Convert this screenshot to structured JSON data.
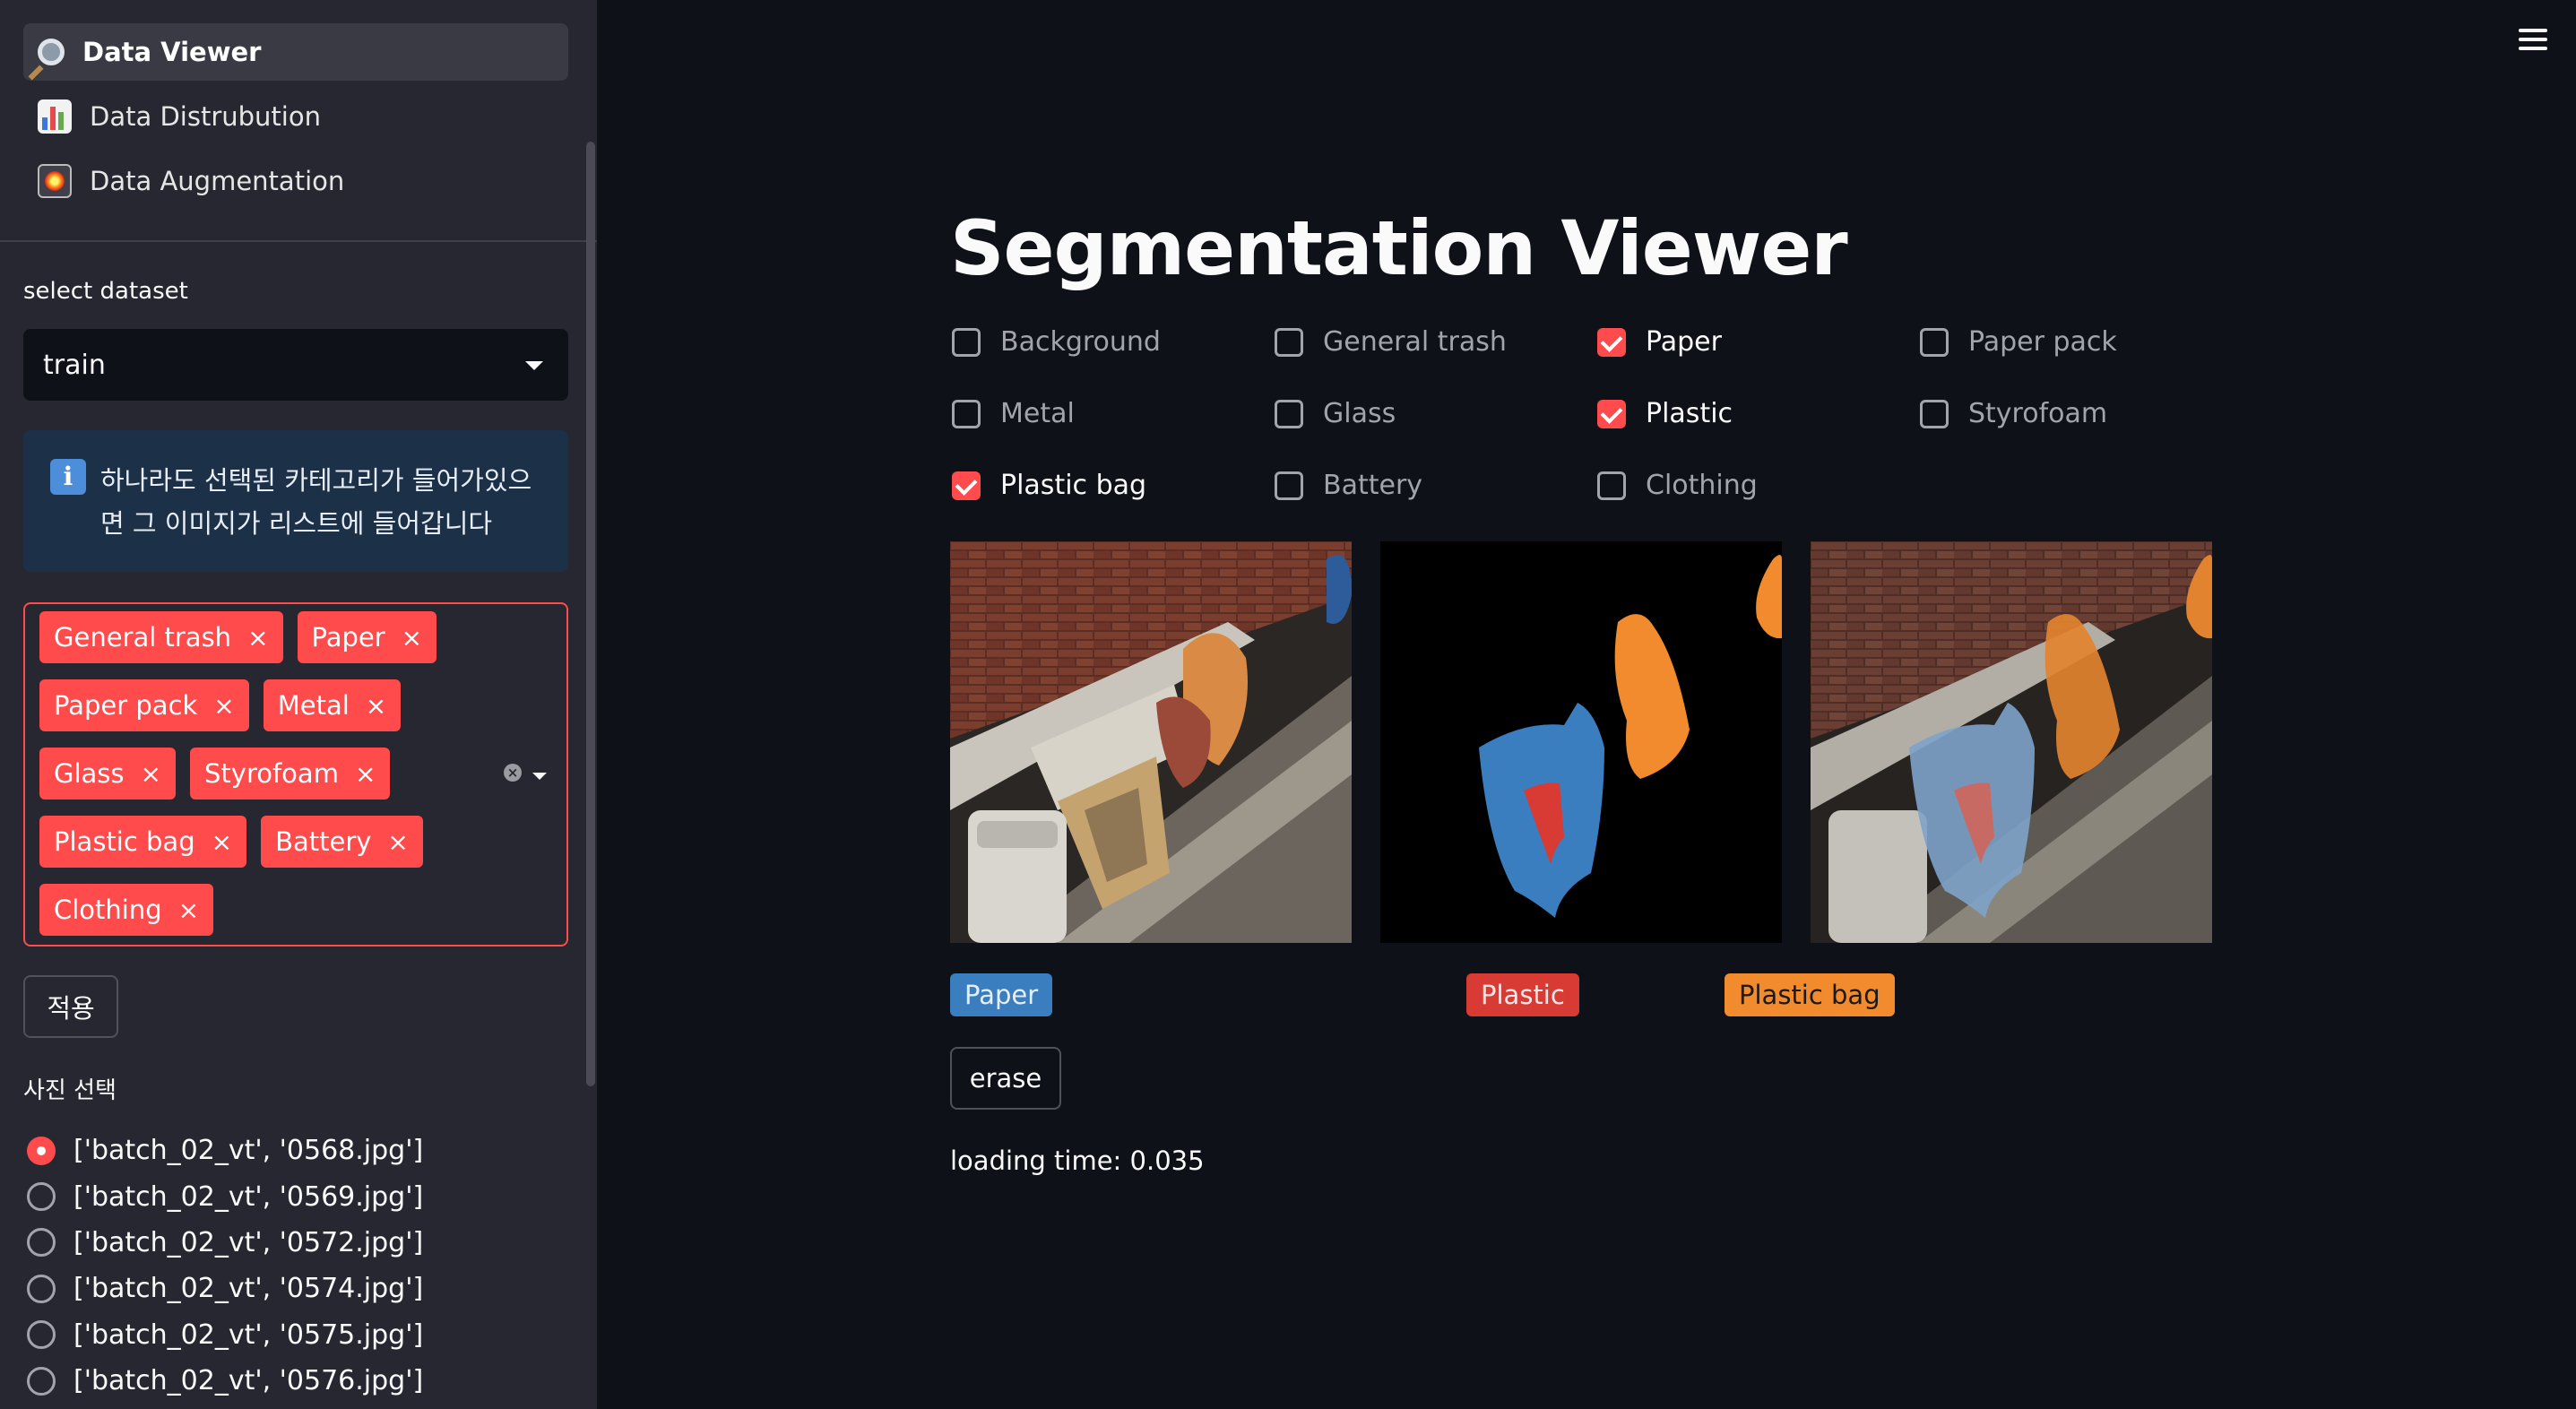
{
  "sidebar": {
    "nav": [
      {
        "label": "Data Viewer",
        "icon": "magnifier-icon",
        "active": true
      },
      {
        "label": "Data Distrubution",
        "icon": "bar-chart-icon",
        "active": false
      },
      {
        "label": "Data Augmentation",
        "icon": "fireworks-icon",
        "active": false
      }
    ],
    "dataset_label": "select dataset",
    "dataset_value": "train",
    "info_text": "하나라도 선택된 카테고리가 들어가있으면 그 이미지가 리스트에 들어갑니다",
    "info_icon": "information-icon",
    "tags": [
      "General trash",
      "Paper",
      "Paper pack",
      "Metal",
      "Glass",
      "Styrofoam",
      "Plastic bag",
      "Battery",
      "Clothing"
    ],
    "tag_remove": "×",
    "apply_button": "적용",
    "photo_label": "사진 선택",
    "photos": [
      "['batch_02_vt', '0568.jpg']",
      "['batch_02_vt', '0569.jpg']",
      "['batch_02_vt', '0572.jpg']",
      "['batch_02_vt', '0574.jpg']",
      "['batch_02_vt', '0575.jpg']",
      "['batch_02_vt', '0576.jpg']"
    ],
    "selected_photo_index": 0
  },
  "main": {
    "title": "Segmentation Viewer",
    "categories": [
      {
        "label": "Background",
        "checked": false
      },
      {
        "label": "General trash",
        "checked": false
      },
      {
        "label": "Paper",
        "checked": true
      },
      {
        "label": "Paper pack",
        "checked": false
      },
      {
        "label": "Metal",
        "checked": false
      },
      {
        "label": "Glass",
        "checked": false
      },
      {
        "label": "Plastic",
        "checked": true
      },
      {
        "label": "Styrofoam",
        "checked": false
      },
      {
        "label": "Plastic bag",
        "checked": true
      },
      {
        "label": "Battery",
        "checked": false
      },
      {
        "label": "Clothing",
        "checked": false
      }
    ],
    "legend": [
      {
        "label": "Paper",
        "color": "#3a7ebf"
      },
      {
        "label": "Plastic",
        "color": "#d83a34"
      },
      {
        "label": "Plastic bag",
        "color": "#f28a2e"
      }
    ],
    "erase_button": "erase",
    "loading_text": "loading time: 0.035"
  },
  "colors": {
    "accent": "#ff4b4b",
    "sidebar_bg": "#262730",
    "main_bg": "#0e1117"
  }
}
